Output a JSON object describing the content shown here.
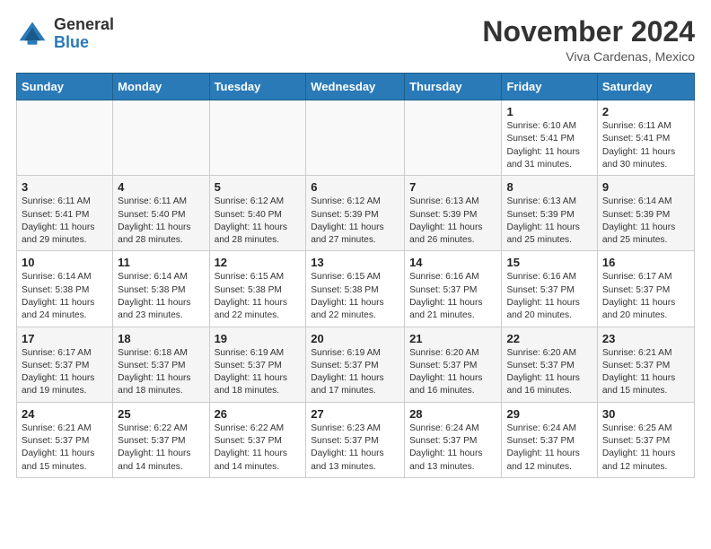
{
  "header": {
    "title": "November 2024",
    "subtitle": "Viva Cardenas, Mexico",
    "logo_general": "General",
    "logo_blue": "Blue"
  },
  "days_of_week": [
    "Sunday",
    "Monday",
    "Tuesday",
    "Wednesday",
    "Thursday",
    "Friday",
    "Saturday"
  ],
  "weeks": [
    [
      {
        "day": "",
        "info": ""
      },
      {
        "day": "",
        "info": ""
      },
      {
        "day": "",
        "info": ""
      },
      {
        "day": "",
        "info": ""
      },
      {
        "day": "",
        "info": ""
      },
      {
        "day": "1",
        "info": "Sunrise: 6:10 AM\nSunset: 5:41 PM\nDaylight: 11 hours\nand 31 minutes."
      },
      {
        "day": "2",
        "info": "Sunrise: 6:11 AM\nSunset: 5:41 PM\nDaylight: 11 hours\nand 30 minutes."
      }
    ],
    [
      {
        "day": "3",
        "info": "Sunrise: 6:11 AM\nSunset: 5:41 PM\nDaylight: 11 hours\nand 29 minutes."
      },
      {
        "day": "4",
        "info": "Sunrise: 6:11 AM\nSunset: 5:40 PM\nDaylight: 11 hours\nand 28 minutes."
      },
      {
        "day": "5",
        "info": "Sunrise: 6:12 AM\nSunset: 5:40 PM\nDaylight: 11 hours\nand 28 minutes."
      },
      {
        "day": "6",
        "info": "Sunrise: 6:12 AM\nSunset: 5:39 PM\nDaylight: 11 hours\nand 27 minutes."
      },
      {
        "day": "7",
        "info": "Sunrise: 6:13 AM\nSunset: 5:39 PM\nDaylight: 11 hours\nand 26 minutes."
      },
      {
        "day": "8",
        "info": "Sunrise: 6:13 AM\nSunset: 5:39 PM\nDaylight: 11 hours\nand 25 minutes."
      },
      {
        "day": "9",
        "info": "Sunrise: 6:14 AM\nSunset: 5:39 PM\nDaylight: 11 hours\nand 25 minutes."
      }
    ],
    [
      {
        "day": "10",
        "info": "Sunrise: 6:14 AM\nSunset: 5:38 PM\nDaylight: 11 hours\nand 24 minutes."
      },
      {
        "day": "11",
        "info": "Sunrise: 6:14 AM\nSunset: 5:38 PM\nDaylight: 11 hours\nand 23 minutes."
      },
      {
        "day": "12",
        "info": "Sunrise: 6:15 AM\nSunset: 5:38 PM\nDaylight: 11 hours\nand 22 minutes."
      },
      {
        "day": "13",
        "info": "Sunrise: 6:15 AM\nSunset: 5:38 PM\nDaylight: 11 hours\nand 22 minutes."
      },
      {
        "day": "14",
        "info": "Sunrise: 6:16 AM\nSunset: 5:37 PM\nDaylight: 11 hours\nand 21 minutes."
      },
      {
        "day": "15",
        "info": "Sunrise: 6:16 AM\nSunset: 5:37 PM\nDaylight: 11 hours\nand 20 minutes."
      },
      {
        "day": "16",
        "info": "Sunrise: 6:17 AM\nSunset: 5:37 PM\nDaylight: 11 hours\nand 20 minutes."
      }
    ],
    [
      {
        "day": "17",
        "info": "Sunrise: 6:17 AM\nSunset: 5:37 PM\nDaylight: 11 hours\nand 19 minutes."
      },
      {
        "day": "18",
        "info": "Sunrise: 6:18 AM\nSunset: 5:37 PM\nDaylight: 11 hours\nand 18 minutes."
      },
      {
        "day": "19",
        "info": "Sunrise: 6:19 AM\nSunset: 5:37 PM\nDaylight: 11 hours\nand 18 minutes."
      },
      {
        "day": "20",
        "info": "Sunrise: 6:19 AM\nSunset: 5:37 PM\nDaylight: 11 hours\nand 17 minutes."
      },
      {
        "day": "21",
        "info": "Sunrise: 6:20 AM\nSunset: 5:37 PM\nDaylight: 11 hours\nand 16 minutes."
      },
      {
        "day": "22",
        "info": "Sunrise: 6:20 AM\nSunset: 5:37 PM\nDaylight: 11 hours\nand 16 minutes."
      },
      {
        "day": "23",
        "info": "Sunrise: 6:21 AM\nSunset: 5:37 PM\nDaylight: 11 hours\nand 15 minutes."
      }
    ],
    [
      {
        "day": "24",
        "info": "Sunrise: 6:21 AM\nSunset: 5:37 PM\nDaylight: 11 hours\nand 15 minutes."
      },
      {
        "day": "25",
        "info": "Sunrise: 6:22 AM\nSunset: 5:37 PM\nDaylight: 11 hours\nand 14 minutes."
      },
      {
        "day": "26",
        "info": "Sunrise: 6:22 AM\nSunset: 5:37 PM\nDaylight: 11 hours\nand 14 minutes."
      },
      {
        "day": "27",
        "info": "Sunrise: 6:23 AM\nSunset: 5:37 PM\nDaylight: 11 hours\nand 13 minutes."
      },
      {
        "day": "28",
        "info": "Sunrise: 6:24 AM\nSunset: 5:37 PM\nDaylight: 11 hours\nand 13 minutes."
      },
      {
        "day": "29",
        "info": "Sunrise: 6:24 AM\nSunset: 5:37 PM\nDaylight: 11 hours\nand 12 minutes."
      },
      {
        "day": "30",
        "info": "Sunrise: 6:25 AM\nSunset: 5:37 PM\nDaylight: 11 hours\nand 12 minutes."
      }
    ]
  ]
}
